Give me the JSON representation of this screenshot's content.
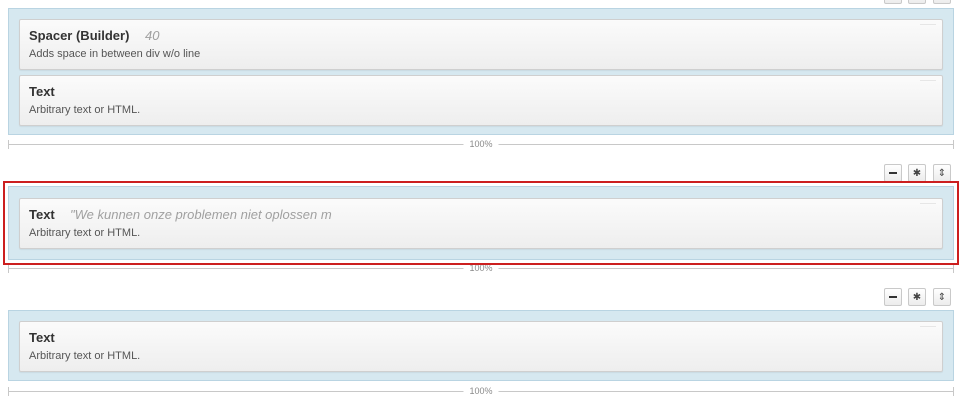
{
  "rows": [
    {
      "modules": [
        {
          "title": "Spacer (Builder)",
          "preview": "40",
          "description": "Adds space in between div w/o line"
        },
        {
          "title": "Text",
          "preview": "",
          "description": "Arbitrary text or HTML."
        }
      ],
      "width_label": "100%"
    },
    {
      "modules": [
        {
          "title": "Text",
          "preview": "\"We kunnen onze problemen niet oplossen m",
          "description": "Arbitrary text or HTML."
        }
      ],
      "width_label": "100%",
      "selected": true
    },
    {
      "modules": [
        {
          "title": "Text",
          "preview": "",
          "description": "Arbitrary text or HTML."
        }
      ],
      "width_label": "100%"
    }
  ],
  "row_controls": {
    "collapse_icon": "minus-icon",
    "settings_icon": "gear-icon",
    "move_icon": "up-down-arrows-icon",
    "settings_glyph": "✱",
    "move_glyph": "⇕"
  },
  "colors": {
    "row_background": "#d6e8f0",
    "selection_outline": "#cc1f1f"
  }
}
